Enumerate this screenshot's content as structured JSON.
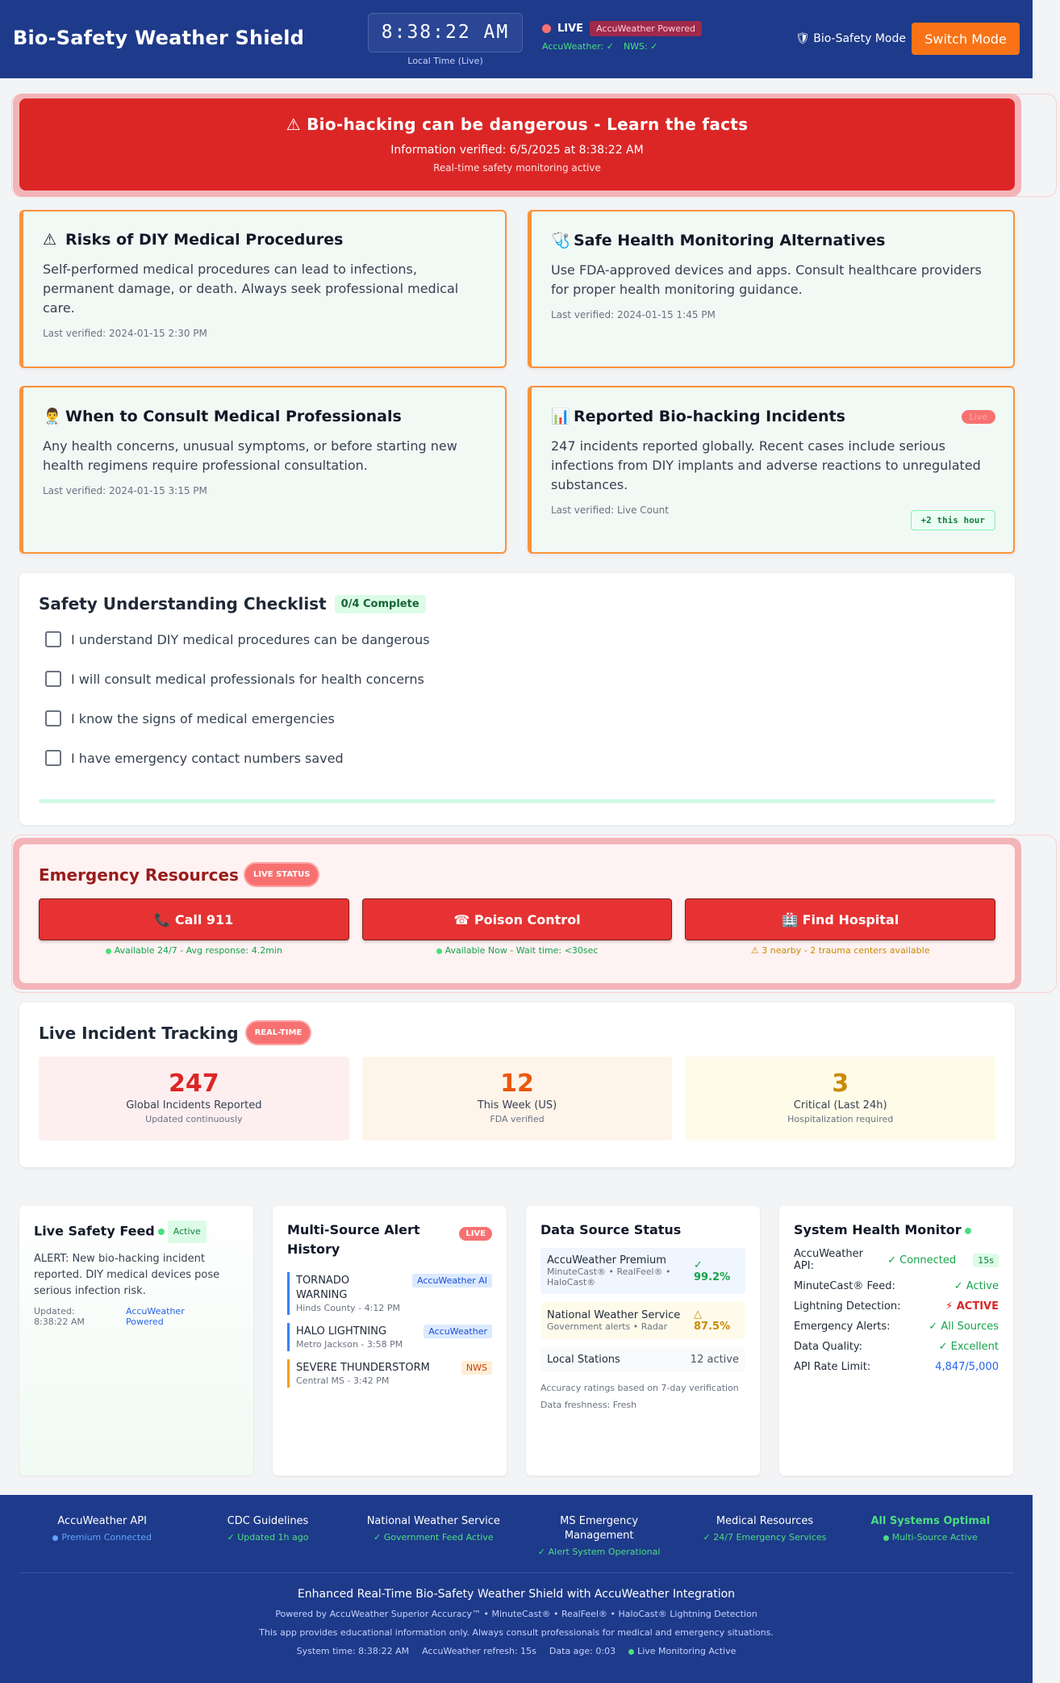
{
  "header": {
    "title": "Bio-Safety Weather Shield",
    "clock": "8:38:22 AM",
    "clock_caption": "Local Time (Live)",
    "live_label": "LIVE",
    "powered_badge": "AccuWeather Powered",
    "source_accuweather": "AccuWeather: ✓",
    "source_nws": "NWS: ✓",
    "mode_label": "🛡 Bio-Safety Mode",
    "switch_button": "Switch Mode"
  },
  "banner": {
    "title": "⚠ Bio-hacking can be dangerous - Learn the facts",
    "verified": "Information verified: 6/5/2025 at 8:38:22 AM",
    "monitoring": "Real-time safety monitoring active"
  },
  "cards": [
    {
      "icon": "⚠",
      "title": "Risks of DIY Medical Procedures",
      "body": "Self-performed medical procedures can lead to infections, permanent damage, or death. Always seek professional medical care.",
      "verified": "Last verified: 2024-01-15 2:30 PM"
    },
    {
      "icon": "🩺",
      "title": "Safe Health Monitoring Alternatives",
      "body": "Use FDA-approved devices and apps. Consult healthcare providers for proper health monitoring guidance.",
      "verified": "Last verified: 2024-01-15 1:45 PM"
    },
    {
      "icon": "👨‍⚕️",
      "title": "When to Consult Medical Professionals",
      "body": "Any health concerns, unusual symptoms, or before starting new health regimens require professional consultation.",
      "verified": "Last verified: 2024-01-15 3:15 PM"
    },
    {
      "icon": "📊",
      "title": "Reported Bio-hacking Incidents",
      "body": "247 incidents reported globally. Recent cases include serious infections from DIY implants and adverse reactions to unregulated substances.",
      "verified": "Last verified: Live Count",
      "pill": "Live",
      "hour_badge": "+2 this hour"
    }
  ],
  "checklist": {
    "title": "Safety Understanding Checklist",
    "complete": "0/4 Complete",
    "progress": 0,
    "items": [
      "I understand DIY medical procedures can be dangerous",
      "I will consult medical professionals for health concerns",
      "I know the signs of medical emergencies",
      "I have emergency contact numbers saved"
    ]
  },
  "emergency": {
    "title": "Emergency Resources",
    "status_pill": "LIVE STATUS",
    "buttons": [
      {
        "label": "📞 Call 911",
        "status": "Available 24/7 - Avg response: 4.2min"
      },
      {
        "label": "☎ Poison Control",
        "status": "Available Now - Wait time: <30sec"
      },
      {
        "label": "🏥 Find Hospital",
        "status": "⚠ 3 nearby - 2 trauma centers available"
      }
    ]
  },
  "tracking": {
    "title": "Live Incident Tracking",
    "pill": "REAL-TIME",
    "stats": [
      {
        "num": "247",
        "label": "Global Incidents Reported",
        "sub": "Updated continuously"
      },
      {
        "num": "12",
        "label": "This Week (US)",
        "sub": "FDA verified"
      },
      {
        "num": "3",
        "label": "Critical (Last 24h)",
        "sub": "Hospitalization required"
      }
    ]
  },
  "feed": {
    "title": "Live Safety Feed",
    "badge": "Active",
    "message": "ALERT: New bio-hacking incident reported. DIY medical devices pose serious infection risk.",
    "updated": "Updated: 8:38:22 AM",
    "source": "AccuWeather Powered"
  },
  "alert_history": {
    "title": "Multi-Source Alert History",
    "pill": "LIVE",
    "items": [
      {
        "name": "TORNADO WARNING",
        "meta": "Hinds County - 4:12 PM",
        "source": "AccuWeather AI"
      },
      {
        "name": "HALO LIGHTNING",
        "meta": "Metro Jackson - 3:58 PM",
        "source": "AccuWeather"
      },
      {
        "name": "SEVERE THUNDERSTORM",
        "meta": "Central MS - 3:42 PM",
        "source": "NWS"
      }
    ]
  },
  "data_sources": {
    "title": "Data Source Status",
    "items": [
      {
        "name": "AccuWeather Premium",
        "sub": "MinuteCast® • RealFeel® • HaloCast®",
        "value": "✓ 99.2%"
      },
      {
        "name": "National Weather Service",
        "sub": "Government alerts • Radar",
        "value": "△ 87.5%"
      },
      {
        "name": "Local Stations",
        "sub": "",
        "value": "12 active"
      }
    ],
    "note1": "Accuracy ratings based on 7-day verification",
    "note2": "Data freshness: Fresh"
  },
  "health": {
    "title": "System Health Monitor",
    "rows": [
      {
        "label": "AccuWeather API:",
        "value": "✓ Connected",
        "badge": "15s"
      },
      {
        "label": "MinuteCast® Feed:",
        "value": "✓ Active"
      },
      {
        "label": "Lightning Detection:",
        "value": "⚡ ACTIVE"
      },
      {
        "label": "Emergency Alerts:",
        "value": "✓ All Sources"
      },
      {
        "label": "Data Quality:",
        "value": "✓ Excellent"
      },
      {
        "label": "API Rate Limit:",
        "value": "4,847/5,000"
      }
    ]
  },
  "footer": {
    "cols": [
      {
        "title": "AccuWeather API",
        "status": "Premium Connected"
      },
      {
        "title": "CDC Guidelines",
        "status": "✓ Updated 1h ago"
      },
      {
        "title": "National Weather Service",
        "status": "✓ Government Feed Active"
      },
      {
        "title": "MS Emergency Management",
        "status": "✓ Alert System Operational"
      },
      {
        "title": "Medical Resources",
        "status": "✓ 24/7 Emergency Services"
      },
      {
        "title": "All Systems Optimal",
        "status": "Multi-Source Active"
      }
    ],
    "line1": "Enhanced Real-Time Bio-Safety Weather Shield with AccuWeather Integration",
    "line2": "Powered by AccuWeather Superior Accuracy™ • MinuteCast® • RealFeel® • HaloCast® Lightning Detection",
    "line3": "This app provides educational information only. Always consult professionals for medical and emergency situations.",
    "system_time": "System time: 8:38:22 AM",
    "refresh": "AccuWeather refresh: 15s",
    "data_age": "Data age: 0:03",
    "monitoring": "Live Monitoring Active"
  }
}
